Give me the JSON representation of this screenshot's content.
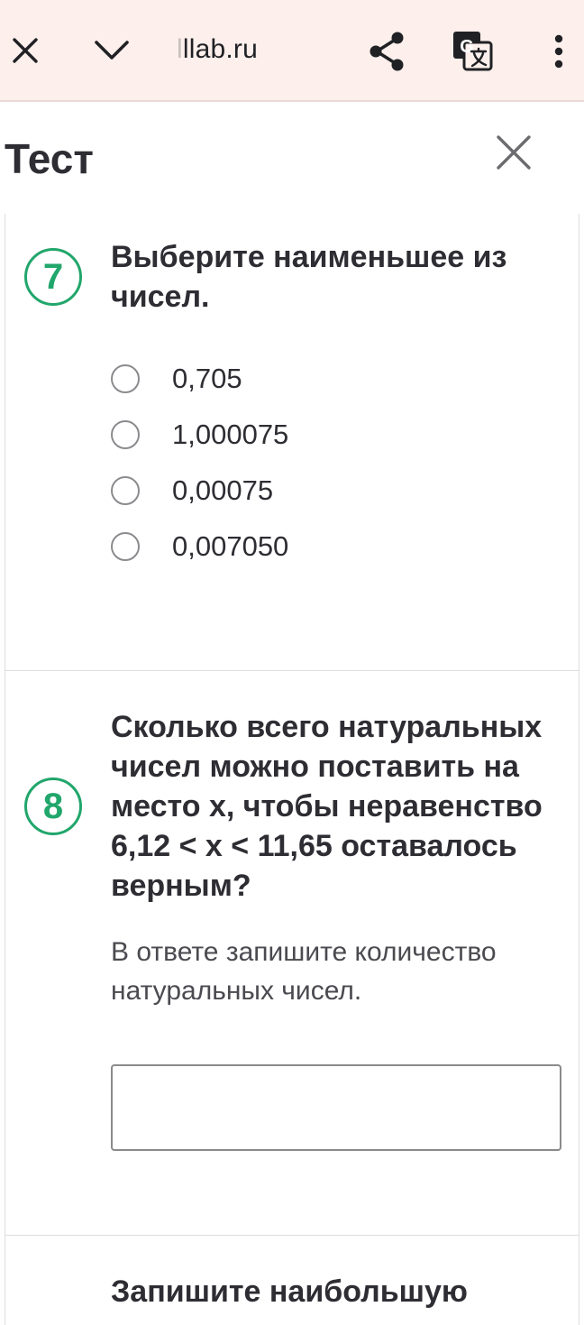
{
  "browser": {
    "url_faded": "l",
    "url_text": "llab.ru"
  },
  "header": {
    "title": "Тест"
  },
  "questions": [
    {
      "number": "7",
      "text": "Выберите наименьшее из чисел.",
      "options": [
        "0,705",
        "1,000075",
        "0,00075",
        "0,007050"
      ]
    },
    {
      "number": "8",
      "text": "Сколько всего натуральных чисел можно поставить на место x, чтобы неравенство 6,12 < x < 11,65 оставалось верным?",
      "hint": "В ответе запишите количество натуральных чисел.",
      "answer_value": ""
    },
    {
      "text": "Запишите наибольшую"
    }
  ],
  "colors": {
    "accent_green": "#21a66b",
    "toolbar_bg": "#fcefec"
  }
}
